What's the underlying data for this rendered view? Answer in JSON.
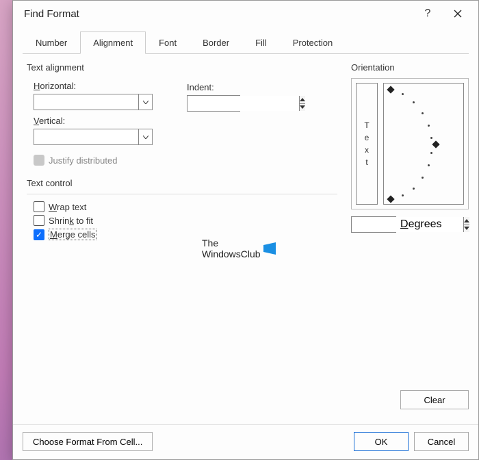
{
  "title": "Find Format",
  "tabs": [
    "Number",
    "Alignment",
    "Font",
    "Border",
    "Fill",
    "Protection"
  ],
  "active_tab_index": 1,
  "alignment": {
    "section_label": "Text alignment",
    "horizontal_label": "Horizontal:",
    "horizontal_value": "",
    "vertical_label": "Vertical:",
    "vertical_value": "",
    "indent_label": "Indent:",
    "indent_value": "",
    "justify_distributed_label": "Justify distributed"
  },
  "text_control": {
    "section_label": "Text control",
    "wrap_label": "Wrap text",
    "wrap_checked": false,
    "shrink_label": "Shrink to fit",
    "shrink_checked": false,
    "merge_label": "Merge cells",
    "merge_checked": true
  },
  "orientation": {
    "section_label": "Orientation",
    "vertical_text": [
      "T",
      "e",
      "x",
      "t"
    ],
    "degrees_label": "Degrees",
    "degrees_value": ""
  },
  "watermark": {
    "line1": "The",
    "line2": "WindowsClub"
  },
  "buttons": {
    "clear": "Clear",
    "choose_format": "Choose Format From Cell...",
    "ok": "OK",
    "cancel": "Cancel"
  }
}
